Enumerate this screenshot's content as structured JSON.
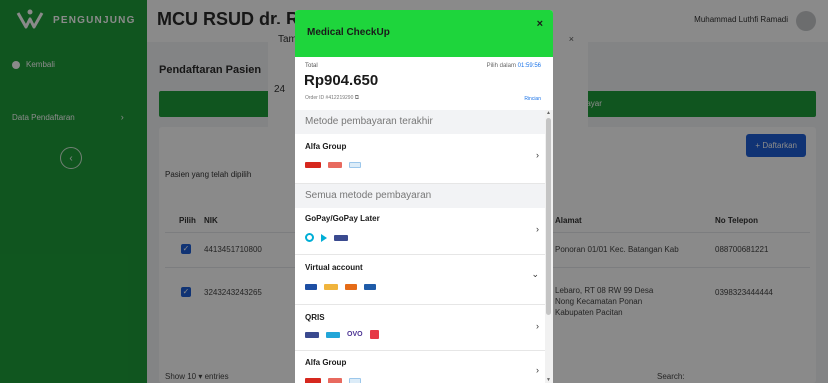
{
  "app": {
    "brand": "PENGUNJUNG",
    "title": "MCU RSUD dr. R",
    "user_name": "Muhammad Luthfi Ramadi"
  },
  "sidebar": {
    "items": [
      {
        "label": "Kembali"
      },
      {
        "label": "Data Pendaftaran"
      }
    ],
    "brand_color": "#1e9e3a"
  },
  "main": {
    "page_title": "Pendaftaran Pasien",
    "green_bar_text": "Bayar",
    "daftarkan_label": "+ Daftarkan",
    "selected_label": "Pasien yang telah dipilih",
    "columns": [
      "Pilih",
      "NIK",
      "Alamat",
      "No Telepon"
    ],
    "rows": [
      {
        "nik": "4413451710800",
        "alamat": "Ponoran 01/01 Kec. Batangan Kab",
        "telepon": "088700681221"
      },
      {
        "nik": "3243243243265",
        "alamat": "Lebaro, RT 08 RW 99 Desa",
        "alamat2": "Nong Kecamatan Ponan",
        "alamat3": "Kabupaten Pacitan",
        "telepon": "0398323444444"
      }
    ],
    "show_entries": "Show  10  ▾  entries",
    "search_label": "Search:"
  },
  "under_dialog": {
    "title": "Tam",
    "prefix": "24",
    "close": "×"
  },
  "modal": {
    "header_title": "Medical CheckUp",
    "close_icon": "×",
    "header_color": "#1ed53c",
    "total_label": "Total",
    "amount": "Rp904.650",
    "order_id": "Order ID #412219290",
    "deadline_label": "Pilih dalam",
    "deadline_timer": "01:59:56",
    "detail_link": "Rincian",
    "recent_title": "Metode pembayaran terakhir",
    "all_title": "Semua metode pembayaran",
    "recent_methods": [
      {
        "name": "Alfa Group",
        "chevron": "›"
      }
    ],
    "all_methods": [
      {
        "name": "GoPay/GoPay Later",
        "chevron": "›"
      },
      {
        "name": "Virtual account",
        "chevron": "⌄"
      },
      {
        "name": "QRIS",
        "chevron": "›"
      },
      {
        "name": "Alfa Group",
        "chevron": "›"
      }
    ],
    "logo_labels": {
      "ovo": "OVO"
    }
  }
}
